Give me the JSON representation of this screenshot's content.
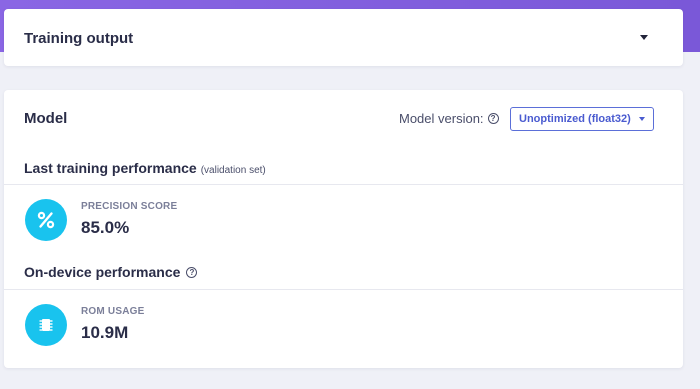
{
  "training_output": {
    "title": "Training output"
  },
  "model": {
    "title": "Model",
    "version_label": "Model version:",
    "version_value": "Unoptimized (float32)",
    "last_training": {
      "heading": "Last training performance",
      "note": "(validation set)",
      "metric_label": "PRECISION SCORE",
      "metric_value": "85.0%",
      "icon": "percent-icon"
    },
    "on_device": {
      "heading": "On-device performance",
      "metric_label": "ROM USAGE",
      "metric_value": "10.9M",
      "icon": "chip-icon"
    }
  },
  "colors": {
    "header_gradient": [
      "#8a66e4",
      "#7a58d8"
    ],
    "accent_cyan": "#19c3ee",
    "link_blue": "#4a5bd0",
    "page_bg": "#eff0f7"
  }
}
